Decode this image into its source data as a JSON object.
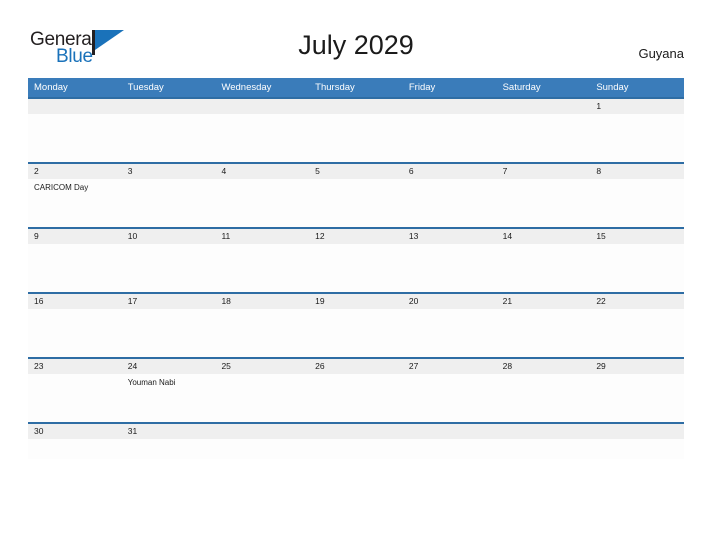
{
  "brand": {
    "name_part1": "General",
    "name_part2": "Blue",
    "flag_icon": "flag-icon"
  },
  "header": {
    "title": "July 2029",
    "country": "Guyana"
  },
  "calendar": {
    "weekdays": [
      "Monday",
      "Tuesday",
      "Wednesday",
      "Thursday",
      "Friday",
      "Saturday",
      "Sunday"
    ],
    "accent_color": "#3a7cba",
    "row_border_color": "#2e6da4",
    "date_band_color": "#efefef",
    "weeks": [
      {
        "dates": [
          "",
          "",
          "",
          "",
          "",
          "",
          "1"
        ],
        "events": [
          "",
          "",
          "",
          "",
          "",
          "",
          ""
        ]
      },
      {
        "dates": [
          "2",
          "3",
          "4",
          "5",
          "6",
          "7",
          "8"
        ],
        "events": [
          "CARICOM Day",
          "",
          "",
          "",
          "",
          "",
          ""
        ]
      },
      {
        "dates": [
          "9",
          "10",
          "11",
          "12",
          "13",
          "14",
          "15"
        ],
        "events": [
          "",
          "",
          "",
          "",
          "",
          "",
          ""
        ]
      },
      {
        "dates": [
          "16",
          "17",
          "18",
          "19",
          "20",
          "21",
          "22"
        ],
        "events": [
          "",
          "",
          "",
          "",
          "",
          "",
          ""
        ]
      },
      {
        "dates": [
          "23",
          "24",
          "25",
          "26",
          "27",
          "28",
          "29"
        ],
        "events": [
          "",
          "Youman Nabi",
          "",
          "",
          "",
          "",
          ""
        ]
      },
      {
        "dates": [
          "30",
          "31",
          "",
          "",
          "",
          "",
          ""
        ],
        "events": [
          "",
          "",
          "",
          "",
          "",
          "",
          ""
        ]
      }
    ]
  }
}
